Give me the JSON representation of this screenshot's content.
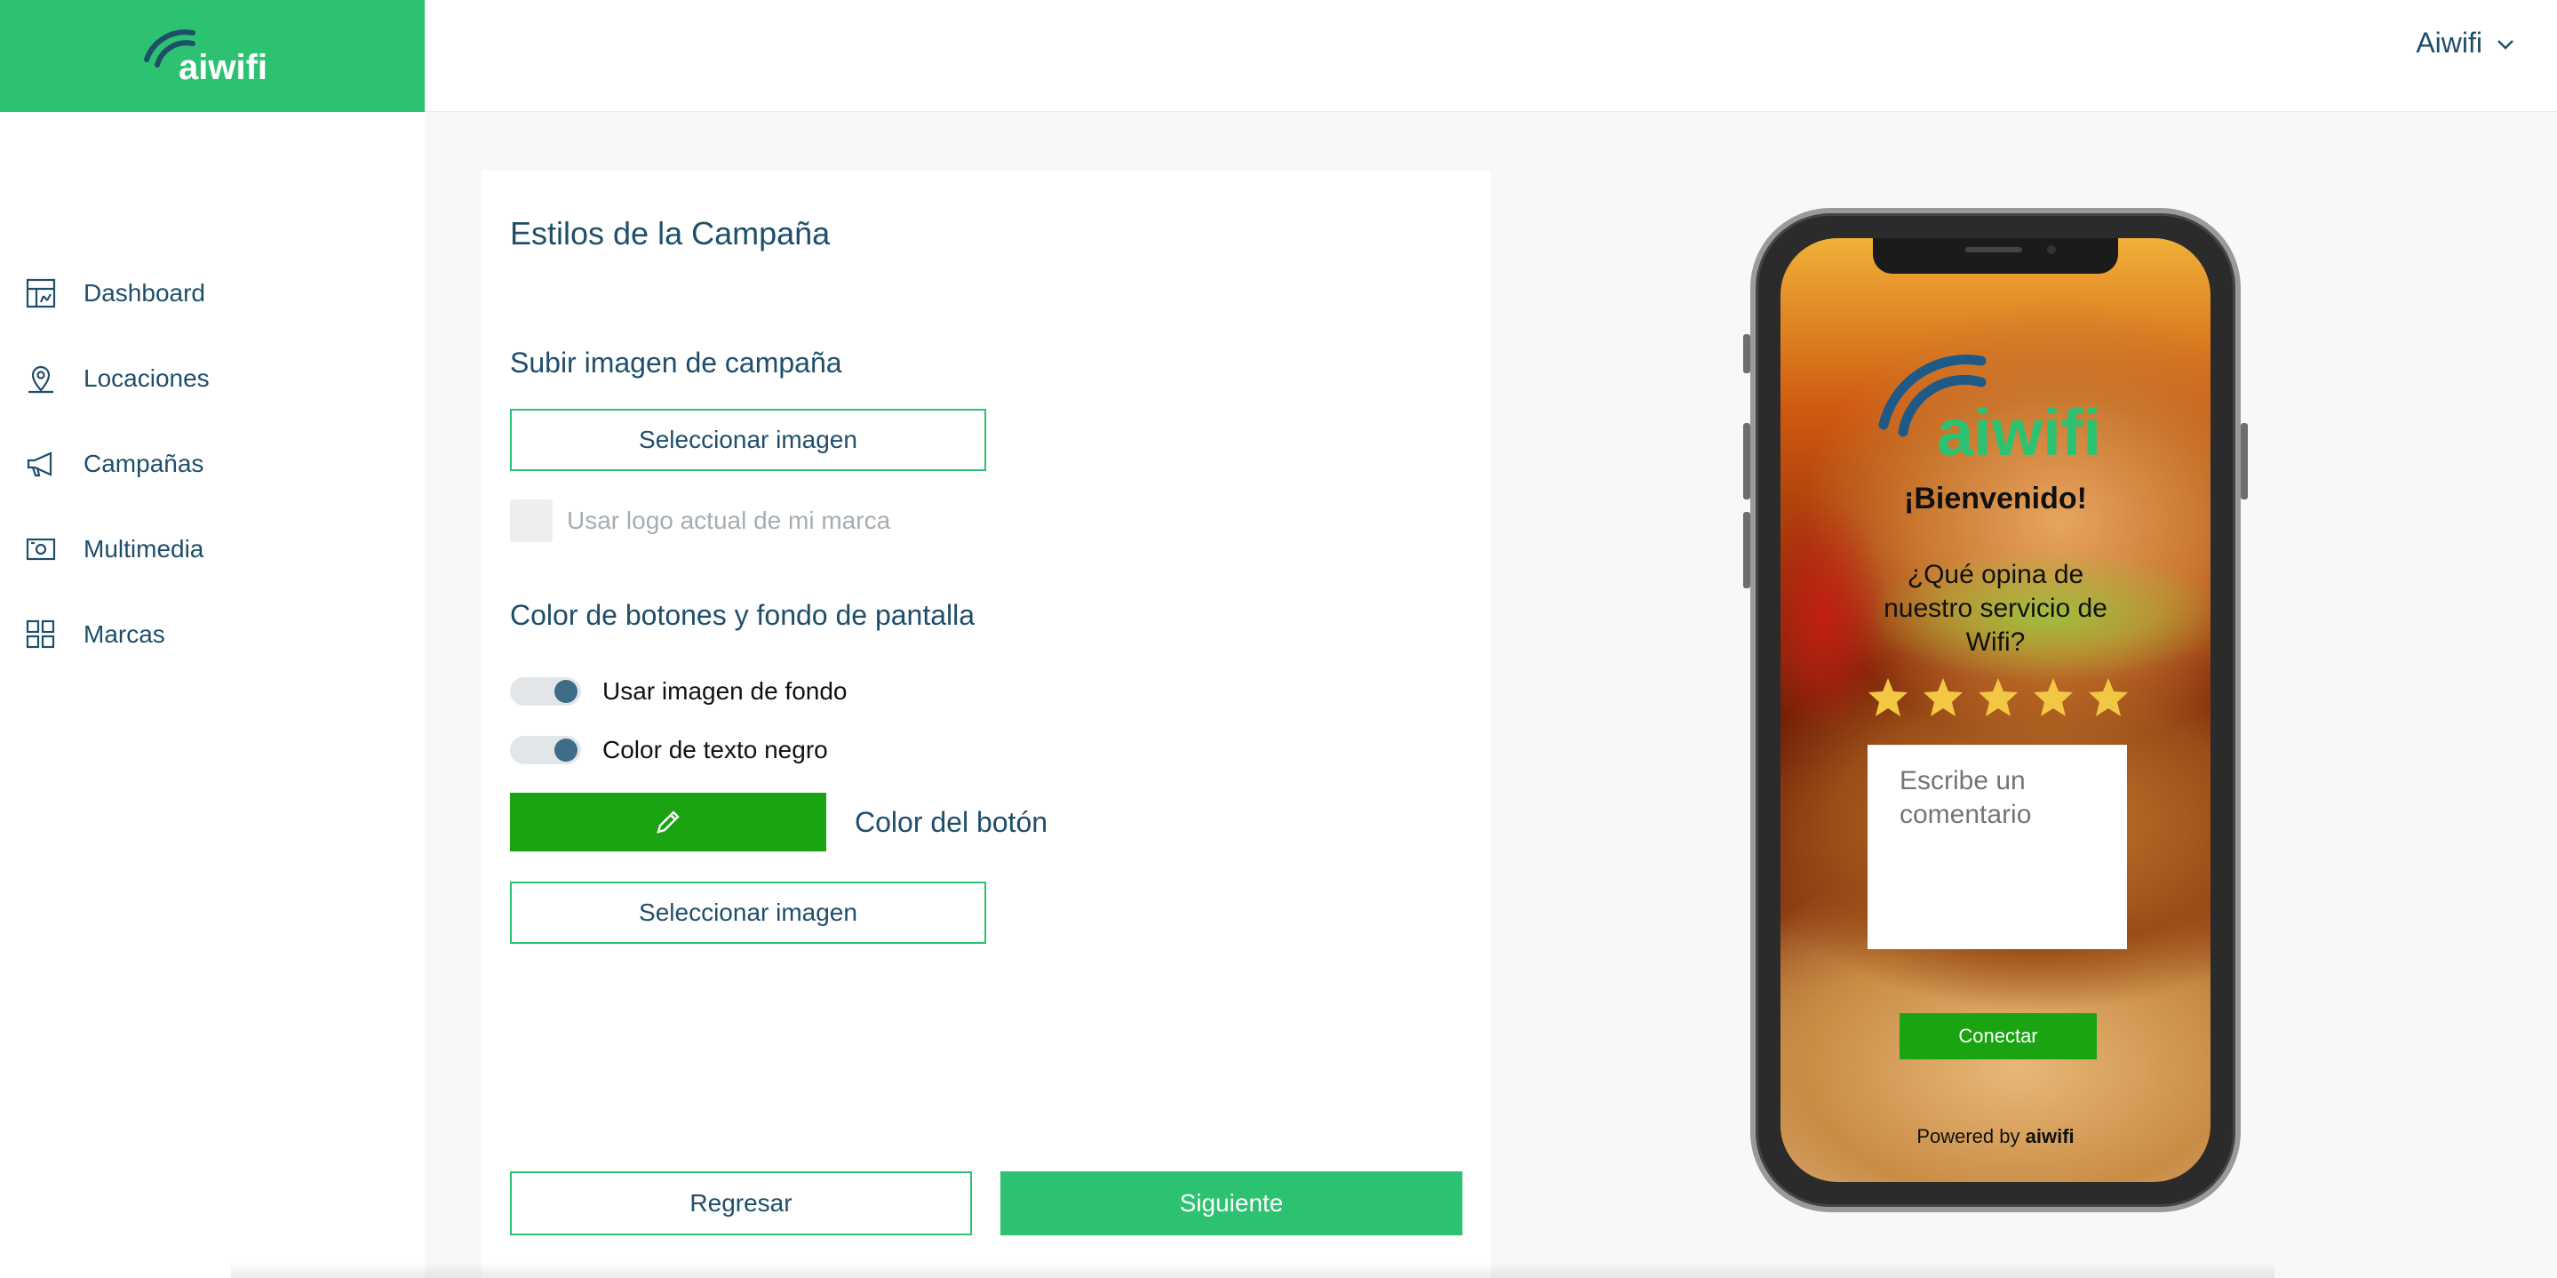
{
  "brand": {
    "logo_text": "aiwifi",
    "accent": "#2cc271"
  },
  "header": {
    "user_name": "Aiwifi"
  },
  "sidebar": {
    "items": [
      {
        "label": "Dashboard",
        "icon": "dashboard-icon"
      },
      {
        "label": "Locaciones",
        "icon": "location-pin-icon"
      },
      {
        "label": "Campañas",
        "icon": "megaphone-icon"
      },
      {
        "label": "Multimedia",
        "icon": "media-icon"
      },
      {
        "label": "Marcas",
        "icon": "grid-icon"
      }
    ]
  },
  "form": {
    "title": "Estilos de la Campaña",
    "upload_section_title": "Subir imagen de campaña",
    "select_image_label": "Seleccionar imagen",
    "use_logo_label": "Usar logo actual de mi marca",
    "use_logo_checked": false,
    "color_section_title": "Color de botones y fondo de pantalla",
    "toggle_bg_image_label": "Usar imagen de fondo",
    "toggle_bg_image_on": true,
    "toggle_black_text_label": "Color de texto negro",
    "toggle_black_text_on": true,
    "button_color": "#1aa412",
    "button_color_label": "Color del botón",
    "select_image_label_2": "Seleccionar imagen",
    "back_label": "Regresar",
    "next_label": "Siguiente"
  },
  "preview": {
    "logo_text": "aiwifi",
    "welcome": "¡Bienvenido!",
    "question": "¿Qué opina de nuestro servicio de Wifi?",
    "rating_stars": 5,
    "comment_placeholder": "Escribe un comentario",
    "connect_label": "Conectar",
    "powered_by": "Powered by",
    "powered_brand": "aiwifi"
  }
}
